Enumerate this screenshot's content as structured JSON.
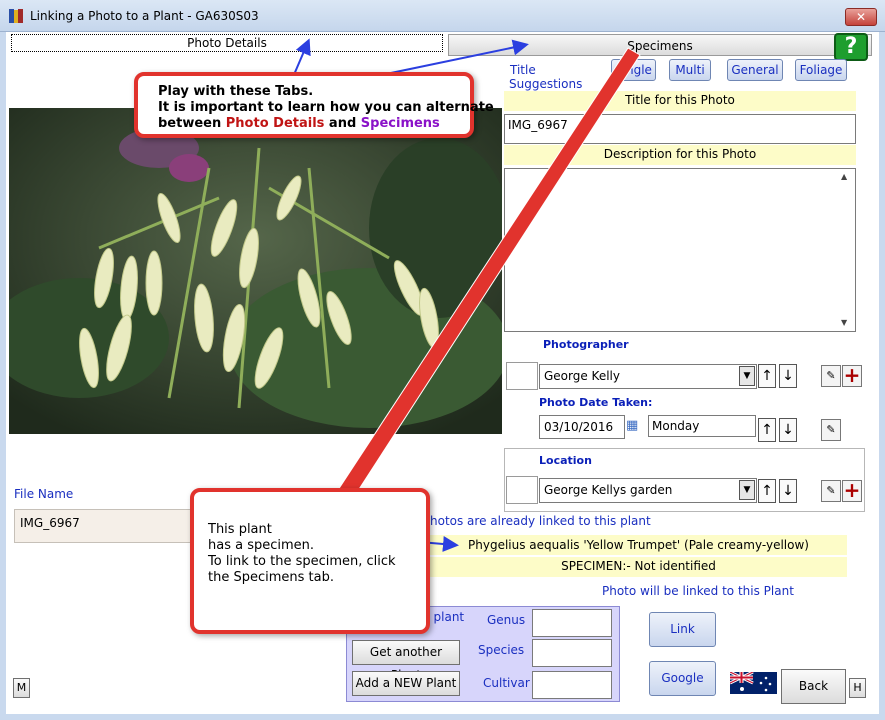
{
  "window": {
    "title": "Linking a Photo to a Plant - GA630S03",
    "close_glyph": "✕"
  },
  "tabs": {
    "photo_details": "Photo Details",
    "specimens": "Specimens"
  },
  "help_glyph": "?",
  "title_suggestions": {
    "label_line1": "Title",
    "label_line2": "Suggestions",
    "buttons": [
      "Single",
      "Multi",
      "General",
      "Foliage"
    ]
  },
  "title_section": {
    "header": "Title for this Photo",
    "value": "IMG_6967"
  },
  "description_section": {
    "header": "Description for this Photo",
    "value": ""
  },
  "photographer": {
    "label": "Photographer",
    "value": "George Kelly"
  },
  "photo_date": {
    "label": "Photo Date Taken:",
    "date": "03/10/2016",
    "day": "Monday"
  },
  "location": {
    "label": "Location",
    "value": "George Kellys garden"
  },
  "file_name": {
    "label": "File Name",
    "value": "IMG_6967"
  },
  "linked_info": {
    "photos_already_linked": "hotos are already linked to this plant",
    "plant_name": "Phygelius aequalis 'Yellow Trumpet' (Pale creamy-yellow)",
    "specimen_status": "SPECIMEN:- Not identified",
    "will_be_linked": "Photo will be linked to this Plant"
  },
  "plant_panel": {
    "title_fragment": "t plant",
    "genus_label": "Genus",
    "species_label": "Species",
    "cultivar_label": "Cultivar",
    "genus_value": "",
    "species_value": "",
    "cultivar_value": "",
    "get_another_label": "Get another Plant",
    "add_new_label": "Add a NEW Plant"
  },
  "action_buttons": {
    "link": "Link",
    "google": "Google",
    "back": "Back",
    "m": "M",
    "h": "H"
  },
  "glyphs": {
    "up": "↑",
    "down": "↓",
    "dropdown": "▼",
    "edit": "✎",
    "plus": "+",
    "scroll_up": "▲",
    "scroll_down": "▼",
    "calendar": "▦"
  },
  "callout_tabs": {
    "line1": "Play with these Tabs.",
    "line2": "It is important to learn how you can alternate",
    "line3_prefix": "between ",
    "line3_red": "Photo Details",
    "line3_mid": " and ",
    "line3_purple": "Specimens"
  },
  "callout_specimen": {
    "line1": "This plant",
    "line2": "has a specimen.",
    "line3": "To link to the specimen, click",
    "line4": "the Specimens tab."
  },
  "colors": {
    "accent_blue": "#1a2fc0",
    "highlight_yellow": "#fdfcc8",
    "callout_red": "#e1332d",
    "panel_lavender": "#d7d5fb"
  }
}
